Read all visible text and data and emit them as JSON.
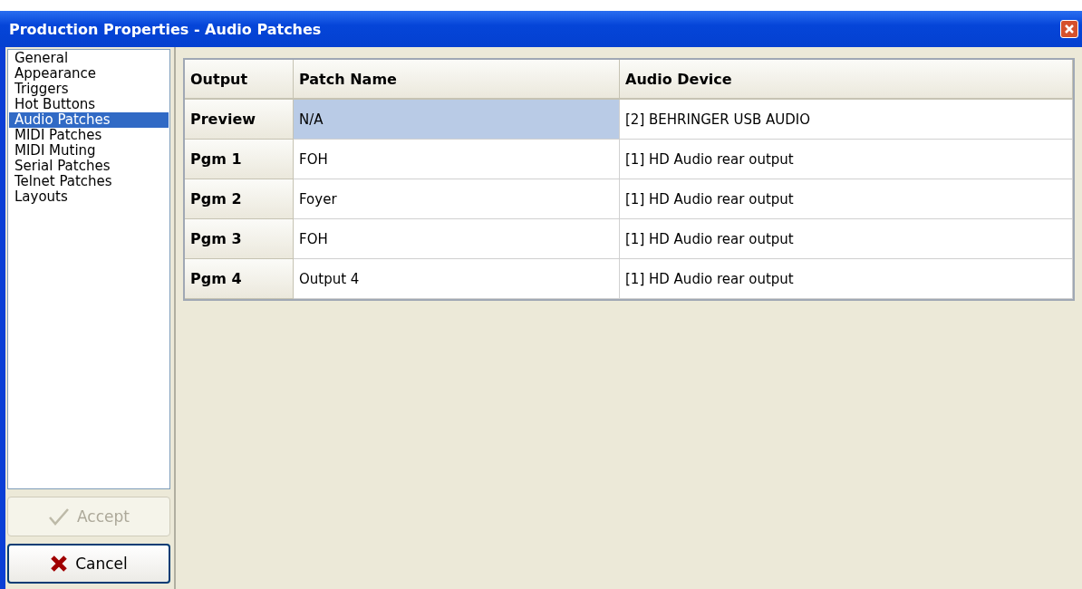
{
  "window": {
    "title": "Production Properties - Audio Patches"
  },
  "sidebar": {
    "items": [
      {
        "label": "General",
        "selected": false
      },
      {
        "label": "Appearance",
        "selected": false
      },
      {
        "label": "Triggers",
        "selected": false
      },
      {
        "label": "Hot Buttons",
        "selected": false
      },
      {
        "label": "Audio Patches",
        "selected": true
      },
      {
        "label": "MIDI Patches",
        "selected": false
      },
      {
        "label": "MIDI Muting",
        "selected": false
      },
      {
        "label": "Serial Patches",
        "selected": false
      },
      {
        "label": "Telnet Patches",
        "selected": false
      },
      {
        "label": "Layouts",
        "selected": false
      }
    ]
  },
  "buttons": [
    {
      "kind": "accept",
      "label": "Accept",
      "disabled": true
    },
    {
      "kind": "cancel",
      "label": "Cancel",
      "disabled": false
    }
  ],
  "table": {
    "columns": [
      "Output",
      "Patch Name",
      "Audio Device"
    ],
    "rows": [
      {
        "output": "Preview",
        "patch": "N/A",
        "device": "[2] BEHRINGER USB AUDIO",
        "selected": true
      },
      {
        "output": "Pgm 1",
        "patch": "FOH",
        "device": "[1] HD Audio rear output",
        "selected": false
      },
      {
        "output": "Pgm 2",
        "patch": "Foyer",
        "device": "[1] HD Audio rear output",
        "selected": false
      },
      {
        "output": "Pgm 3",
        "patch": "FOH",
        "device": "[1] HD Audio rear output",
        "selected": false
      },
      {
        "output": "Pgm 4",
        "patch": "Output 4",
        "device": "[1] HD Audio rear output",
        "selected": false
      }
    ]
  }
}
